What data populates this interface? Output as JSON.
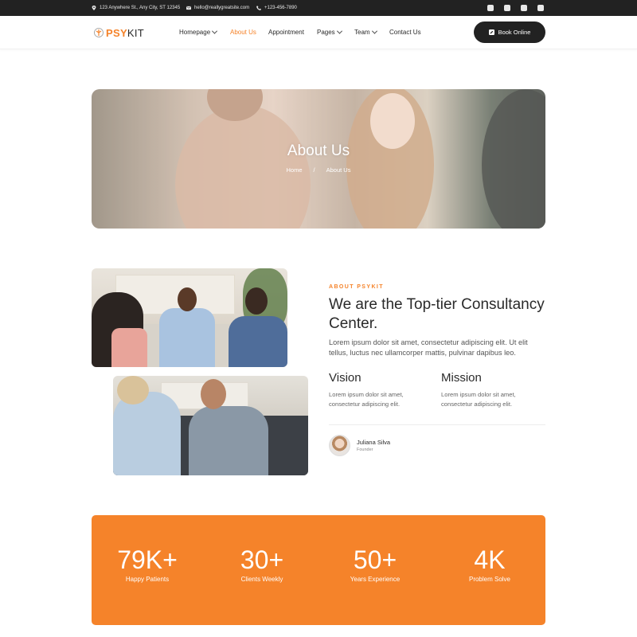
{
  "topbar": {
    "address": "123 Anywhere St., Any City, ST 12345",
    "email": "hello@reallygreatsite.com",
    "phone": "+123-456-7890",
    "social": [
      "facebook-icon",
      "instagram-icon",
      "twitter-icon",
      "youtube-icon"
    ]
  },
  "nav": {
    "logo_part1": "PSY",
    "logo_part2": "KIT",
    "items": [
      {
        "label": "Homepage",
        "dropdown": true
      },
      {
        "label": "About Us",
        "active": true
      },
      {
        "label": "Appointment"
      },
      {
        "label": "Pages",
        "dropdown": true
      },
      {
        "label": "Team",
        "dropdown": true
      },
      {
        "label": "Contact Us"
      }
    ],
    "book_label": "Book Online"
  },
  "hero": {
    "title": "About Us",
    "breadcrumb_home": "Home",
    "breadcrumb_sep": "/",
    "breadcrumb_current": "About Us"
  },
  "about": {
    "eyebrow": "ABOUT PSYKIT",
    "title": "We are the Top-tier Consultancy Center.",
    "paragraph": "Lorem ipsum dolor sit amet, consectetur adipiscing elit. Ut elit tellus, luctus nec ullamcorper mattis, pulvinar dapibus leo.",
    "vision_title": "Vision",
    "vision_text": "Lorem ipsum dolor sit amet, consectetur adipiscing elit.",
    "mission_title": "Mission",
    "mission_text": "Lorem ipsum dolor sit amet, consectetur adipiscing elit.",
    "founder_name": "Juliana Silva",
    "founder_role": "Founder"
  },
  "stats": [
    {
      "value": "79K+",
      "label": "Happy Patients"
    },
    {
      "value": "30+",
      "label": "Clients Weekly"
    },
    {
      "value": "50+",
      "label": "Years Experience"
    },
    {
      "value": "4K",
      "label": "Problem Solve"
    }
  ],
  "colors": {
    "accent": "#f5832a",
    "dark": "#222222"
  }
}
